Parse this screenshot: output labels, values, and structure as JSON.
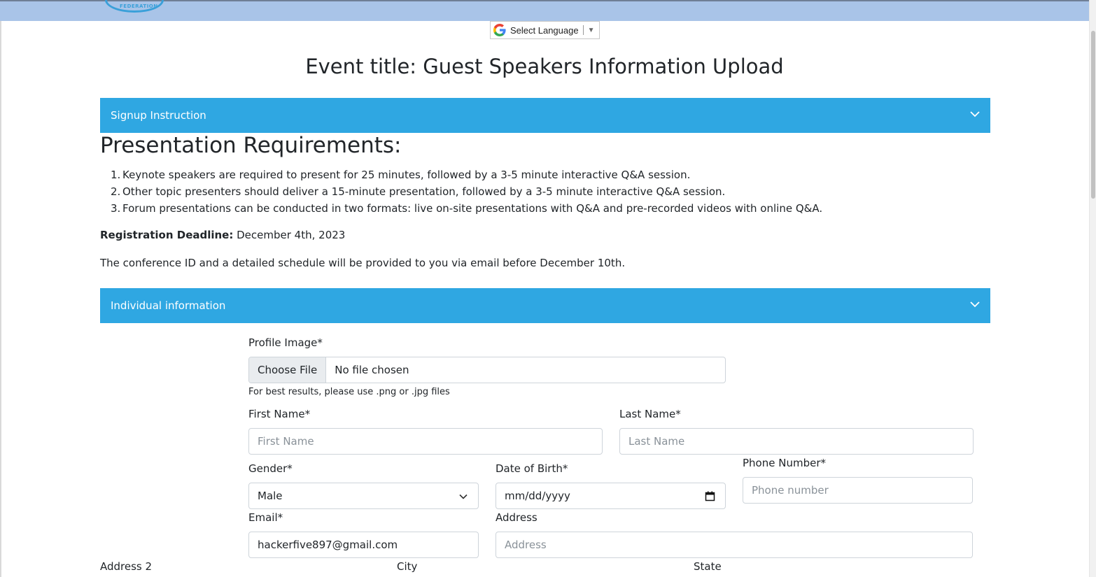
{
  "language": {
    "label": "Select Language",
    "arrow": "▼"
  },
  "page": {
    "title": "Event title: Guest Speakers Information Upload"
  },
  "sections": {
    "signup": "Signup Instruction",
    "individual": "Individual information"
  },
  "requirements": {
    "heading": "Presentation Requirements:",
    "items": [
      {
        "num": "1.",
        "text": "Keynote speakers are required to present for 25 minutes, followed by a 3-5 minute interactive Q&A session."
      },
      {
        "num": "2.",
        "text": "Other topic presenters should deliver a 15-minute presentation, followed by a 3-5 minute interactive Q&A session."
      },
      {
        "num": "3.",
        "text": "Forum presentations can be conducted in two formats: live on-site presentations with Q&A and pre-recorded videos with online Q&A."
      }
    ],
    "deadline_label": "Registration Deadline:",
    "deadline_value": " December 4th, 2023",
    "note": "The conference ID and a detailed schedule will be provided to you via email before December 10th."
  },
  "form": {
    "profile_image": {
      "label": "Profile Image*",
      "button": "Choose File",
      "status": "No file chosen",
      "hint": "For best results, please use .png or .jpg files"
    },
    "first_name": {
      "label": "First Name*",
      "placeholder": "First Name"
    },
    "last_name": {
      "label": "Last Name*",
      "placeholder": "Last Name"
    },
    "gender": {
      "label": "Gender*",
      "value": "Male"
    },
    "dob": {
      "label": "Date of Birth*",
      "value": "mm/dd/yyyy"
    },
    "phone": {
      "label": "Phone Number*",
      "placeholder": "Phone number"
    },
    "email": {
      "label": "Email*",
      "value": "hackerfive897@gmail.com"
    },
    "address": {
      "label": "Address",
      "placeholder": "Address"
    },
    "address2": {
      "label": "Address 2"
    },
    "city": {
      "label": "City"
    },
    "state": {
      "label": "State"
    }
  },
  "colors": {
    "accent": "#2fa7e2",
    "topbar": "#a9c4e8"
  }
}
